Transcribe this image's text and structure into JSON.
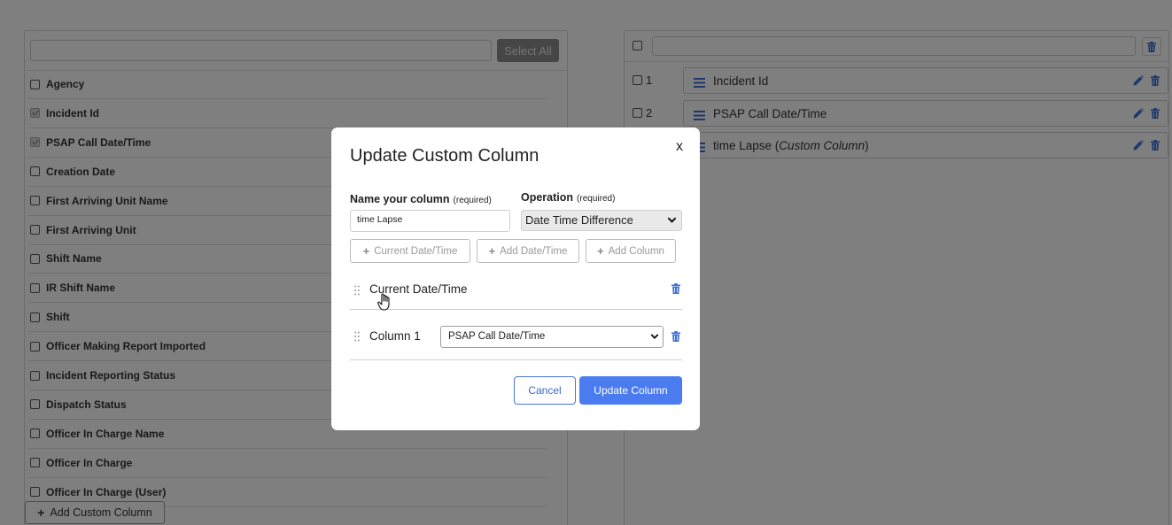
{
  "colors": {
    "accent": "#4a7cf0",
    "icon_blue": "#3d6fd9"
  },
  "left_panel": {
    "search_value": "",
    "select_all_label": "Select All",
    "fields": [
      {
        "label": "Agency",
        "checked": false
      },
      {
        "label": "Incident Id",
        "checked": true
      },
      {
        "label": "PSAP Call Date/Time",
        "checked": true
      },
      {
        "label": "Creation Date",
        "checked": false
      },
      {
        "label": "First Arriving Unit Name",
        "checked": false
      },
      {
        "label": "First Arriving Unit",
        "checked": false
      },
      {
        "label": "Shift Name",
        "checked": false
      },
      {
        "label": "IR Shift Name",
        "checked": false
      },
      {
        "label": "Shift",
        "checked": false
      },
      {
        "label": "Officer Making Report Imported",
        "checked": false
      },
      {
        "label": "Incident Reporting Status",
        "checked": false
      },
      {
        "label": "Dispatch Status",
        "checked": false
      },
      {
        "label": "Officer In Charge Name",
        "checked": false
      },
      {
        "label": "Officer In Charge",
        "checked": false
      },
      {
        "label": "Officer In Charge (User)",
        "checked": false
      }
    ],
    "add_custom_label": "Add Custom Column"
  },
  "right_panel": {
    "search_value": "",
    "columns": [
      {
        "number": "1",
        "label": "Incident Id",
        "custom_tag": ""
      },
      {
        "number": "2",
        "label": "PSAP Call Date/Time",
        "custom_tag": ""
      },
      {
        "number": "",
        "label": "time Lapse (",
        "custom_tag": "Custom Column",
        "suffix": ")"
      }
    ]
  },
  "modal": {
    "title": "Update Custom Column",
    "close_label": "x",
    "name_label": "Name your column",
    "name_required": "(required)",
    "name_value": "time Lapse",
    "operation_label": "Operation",
    "operation_required": "(required)",
    "operation_value": "Date Time Difference",
    "chips": [
      "Current Date/Time",
      "Add Date/Time",
      "Add Column"
    ],
    "row1_label": "Current Date/Time",
    "row2_label": "Column 1",
    "row2_select_value": "PSAP Call Date/Time",
    "cancel_label": "Cancel",
    "update_label": "Update Column"
  }
}
